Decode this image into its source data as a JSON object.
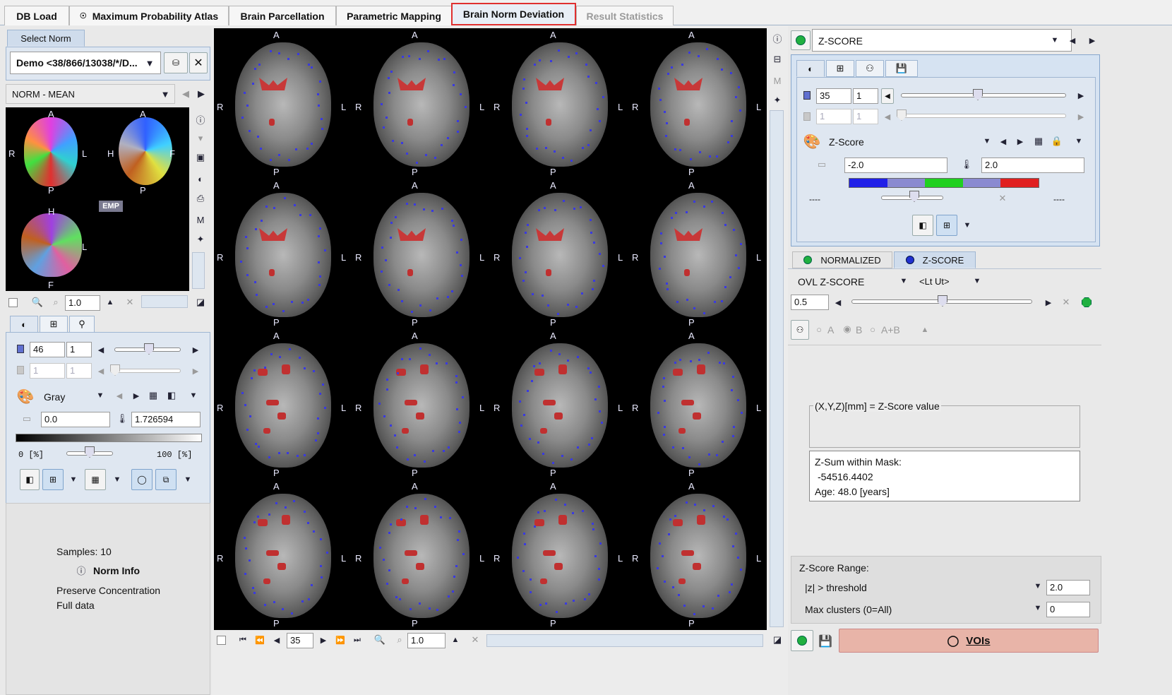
{
  "tabs": [
    {
      "label": "DB Load",
      "state": "normal"
    },
    {
      "label": "Maximum Probability Atlas",
      "state": "normal"
    },
    {
      "label": "Brain Parcellation",
      "state": "normal"
    },
    {
      "label": "Parametric Mapping",
      "state": "normal"
    },
    {
      "label": "Brain Norm Deviation",
      "state": "active"
    },
    {
      "label": "Result Statistics",
      "state": "disabled"
    }
  ],
  "left": {
    "select_norm_tab": "Select Norm",
    "norm_dropdown": "Demo <38/866/13038/*/D...",
    "norm_series": "NORM - MEAN",
    "emp_badge": "EMP",
    "atlas_labels": {
      "a": "A",
      "r": "R",
      "l": "L",
      "p": "P",
      "h": "H",
      "f": "F"
    },
    "zoom_value": "1.0",
    "slice_value": "46",
    "step_value": "1",
    "slice_value_dis": "1",
    "step_value_dis": "1",
    "colormap": "Gray",
    "min_value": "0.0",
    "max_value": "1.726594",
    "pct_low": "0 [%]",
    "pct_high": "100 [%]",
    "samples": "Samples: 10",
    "norm_info": "Norm Info",
    "preserve": "Preserve Concentration",
    "full_data": "Full data"
  },
  "viewer": {
    "orient": {
      "top": "A",
      "bottom": "P",
      "left": "R",
      "right": "L"
    },
    "slice_value": "35",
    "zoom_value": "1.0"
  },
  "right": {
    "series_dropdown": "Z-SCORE",
    "slice_value": "35",
    "step_value": "1",
    "slice_value_dis": "1",
    "step_value_dis": "1",
    "colormap": "Z-Score",
    "min_value": "-2.0",
    "max_value": "2.0",
    "dash_left": "----",
    "dash_right": "----",
    "tab_normalized": "NORMALIZED",
    "tab_zscore": "Z-SCORE",
    "ovl_label": "OVL  Z-SCORE",
    "ovl_mode": "<Lt Ut>",
    "ovl_value": "0.5",
    "radio_a": "A",
    "radio_b": "B",
    "radio_ab": "A+B",
    "coord_title": "(X,Y,Z)[mm] = Z-Score value",
    "zsum_label": "Z-Sum within Mask:",
    "zsum_value": "-54516.4402",
    "age": "Age: 48.0 [years]",
    "range_title": "Z-Score Range:",
    "threshold_label": "|z| > threshold",
    "threshold_value": "2.0",
    "clusters_label": "Max clusters (0=All)",
    "clusters_value": "0",
    "vois_button": "VOIs"
  },
  "colors": {
    "active_tab_border": "#e03030",
    "vois_button": "#e8b4a8",
    "zscore_bar": [
      "#2020e8",
      "#8a8ad0",
      "#20d020",
      "#8a8ad0",
      "#e02020"
    ]
  }
}
